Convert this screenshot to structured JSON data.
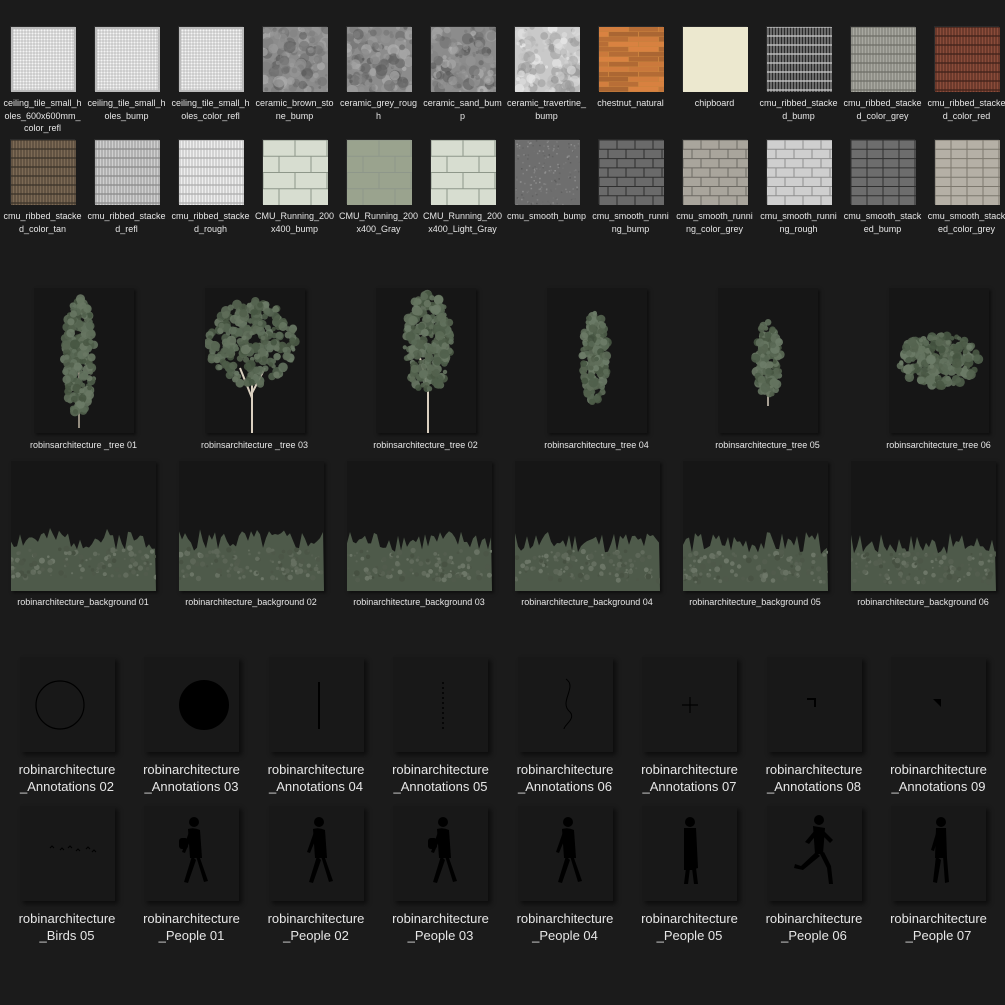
{
  "textures": [
    {
      "label": "ceiling_tile_small_holes_600x600mm_color_refl",
      "style": "grid"
    },
    {
      "label": "ceiling_tile_small_holes_bump",
      "style": "grid"
    },
    {
      "label": "ceiling_tile_small_holes_color_refl",
      "style": "grid"
    },
    {
      "label": "ceramic_brown_stone_bump",
      "style": "noise"
    },
    {
      "label": "ceramic_grey_rough",
      "style": "noise"
    },
    {
      "label": "ceramic_sand_bump",
      "style": "noise"
    },
    {
      "label": "ceramic_travertine_bump",
      "style": "noise-light"
    },
    {
      "label": "chestnut_natural",
      "style": "wood"
    },
    {
      "label": "chipboard",
      "style": "plain"
    },
    {
      "label": "cmu_ribbed_stacked_bump",
      "style": "ribbed-dark"
    },
    {
      "label": "cmu_ribbed_stacked_color_grey",
      "style": "ribbed-grey"
    },
    {
      "label": "cmu_ribbed_stacked_color_red",
      "style": "ribbed-red"
    },
    {
      "label": "cmu_ribbed_stacked_color_tan",
      "style": "ribbed-tan"
    },
    {
      "label": "cmu_ribbed_stacked_refl",
      "style": "ribbed-light"
    },
    {
      "label": "cmu_ribbed_stacked_rough",
      "style": "ribbed-white"
    },
    {
      "label": "CMU_Running_200x400_bump",
      "style": "block-mint"
    },
    {
      "label": "CMU_Running_200x400_Gray",
      "style": "block-green"
    },
    {
      "label": "CMU_Running_200x400_Light_Gray",
      "style": "block-mint"
    },
    {
      "label": "cmu_smooth_bump",
      "style": "smooth"
    },
    {
      "label": "cmu_smooth_running_bump",
      "style": "brick-grey"
    },
    {
      "label": "cmu_smooth_running_color_grey",
      "style": "brick-light"
    },
    {
      "label": "cmu_smooth_running_rough",
      "style": "brick-white"
    },
    {
      "label": "cmu_smooth_stacked_bump",
      "style": "stack-grey"
    },
    {
      "label": "cmu_smooth_stacked_color_grey",
      "style": "stack-light"
    }
  ],
  "trees": [
    {
      "label": "robinsarchitecture _tree 01",
      "kind": "tall"
    },
    {
      "label": "robinsarchitecture _tree 03",
      "kind": "wide"
    },
    {
      "label": "robinsarchitecture_tree 02",
      "kind": "medium"
    },
    {
      "label": "robinsarchitecture_tree 04",
      "kind": "cypress"
    },
    {
      "label": "robinsarchitecture_tree 05",
      "kind": "poplar"
    },
    {
      "label": "robinsarchitecture_tree 06",
      "kind": "bush"
    }
  ],
  "backgrounds": [
    {
      "label": "robinarchitecture_background 01"
    },
    {
      "label": "robinarchitecture_background 02"
    },
    {
      "label": "robinarchitecture_background 03"
    },
    {
      "label": "robinarchitecture_background 04"
    },
    {
      "label": "robinarchitecture_background 05"
    },
    {
      "label": "robinarchitecture_background 06"
    }
  ],
  "annotations": [
    {
      "line1": "robinarchitecture",
      "line2": "_Annotations  02",
      "kind": "circle-outline"
    },
    {
      "line1": "robinarchitecture",
      "line2": "_Annotations  03",
      "kind": "circle-filled"
    },
    {
      "line1": "robinarchitecture",
      "line2": "_Annotations  04",
      "kind": "line-solid"
    },
    {
      "line1": "robinarchitecture",
      "line2": "_Annotations  05",
      "kind": "line-dashed"
    },
    {
      "line1": "robinarchitecture",
      "line2": "_Annotations  06",
      "kind": "curve"
    },
    {
      "line1": "robinarchitecture",
      "line2": "_Annotations  07",
      "kind": "plus"
    },
    {
      "line1": "robinarchitecture",
      "line2": "_Annotations  08",
      "kind": "corner"
    },
    {
      "line1": "robinarchitecture",
      "line2": "_Annotations  09",
      "kind": "arrow"
    }
  ],
  "people": [
    {
      "line1": "robinarchitecture",
      "line2": "_Birds 05",
      "kind": "birds"
    },
    {
      "line1": "robinarchitecture",
      "line2": "_People 01",
      "kind": "walk-bag"
    },
    {
      "line1": "robinarchitecture",
      "line2": "_People 02",
      "kind": "walk"
    },
    {
      "line1": "robinarchitecture",
      "line2": "_People 03",
      "kind": "walk-bag"
    },
    {
      "line1": "robinarchitecture",
      "line2": "_People 04",
      "kind": "walk"
    },
    {
      "line1": "robinarchitecture",
      "line2": "_People 05",
      "kind": "stand-coat"
    },
    {
      "line1": "robinarchitecture",
      "line2": "_People 06",
      "kind": "run"
    },
    {
      "line1": "robinarchitecture",
      "line2": "_People 07",
      "kind": "stand"
    }
  ],
  "colors": {
    "background": "#1b1b1b",
    "label": "#e6e6e6",
    "foliage": "#5b6b55",
    "silhouette": "#000000"
  }
}
